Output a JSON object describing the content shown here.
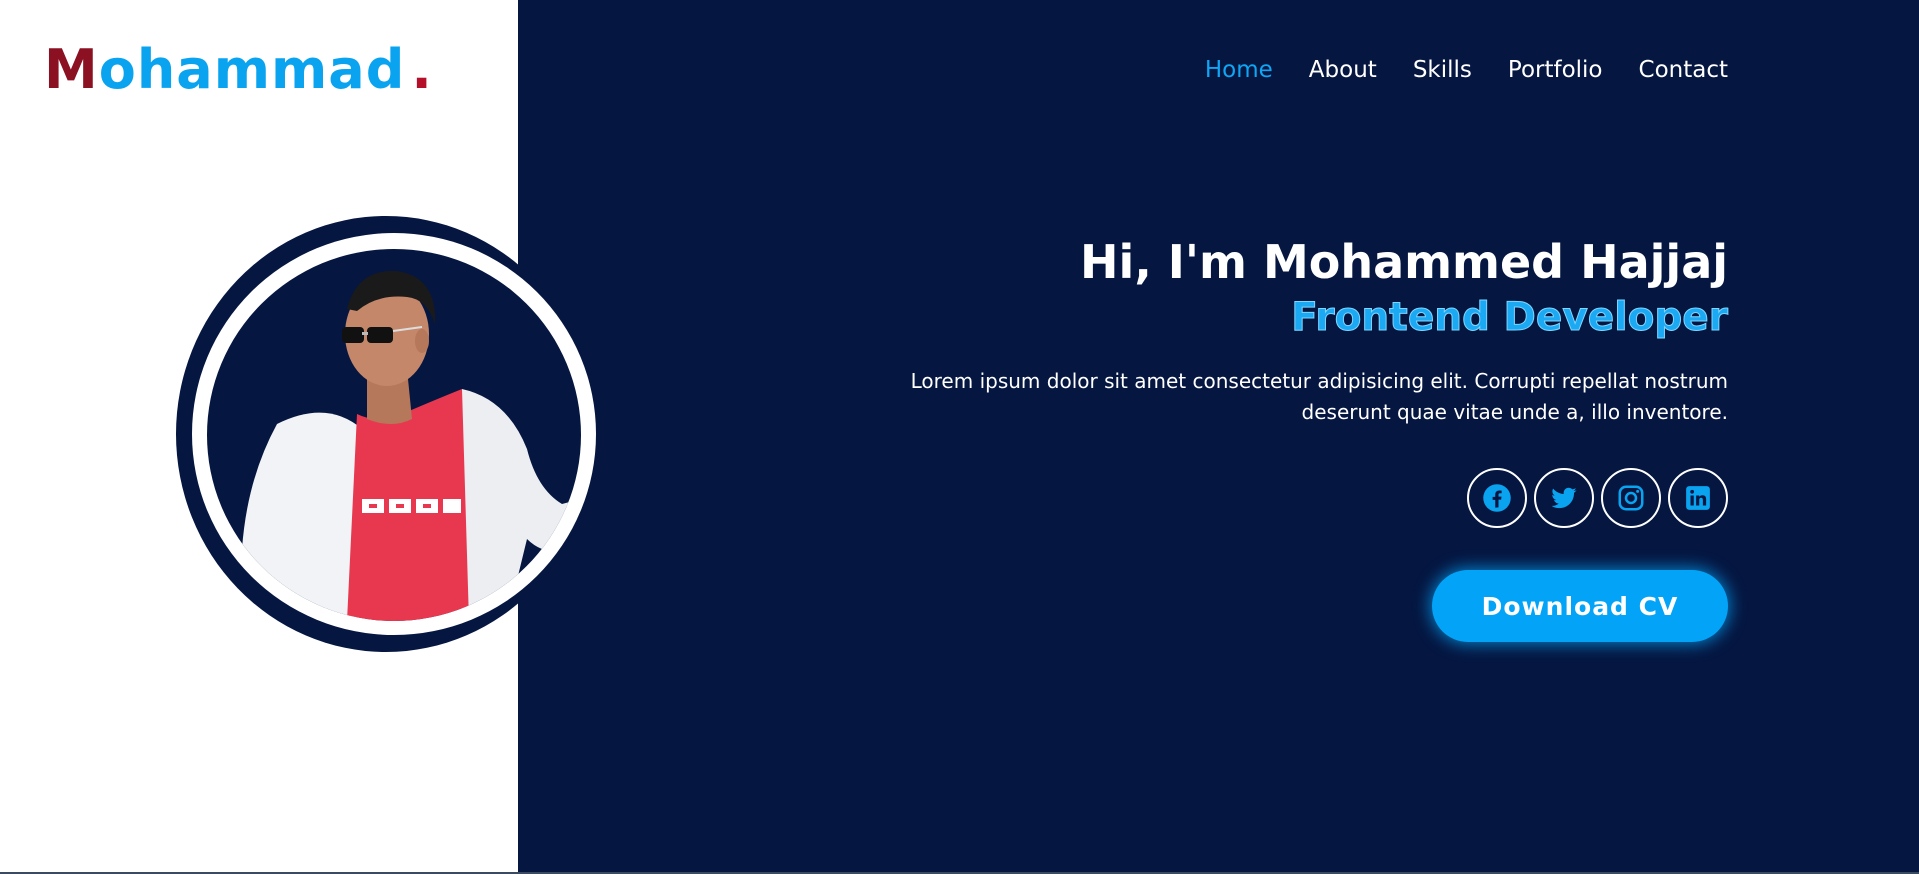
{
  "logo": {
    "first_letter": "M",
    "rest": "ohammad",
    "dot": "."
  },
  "nav": {
    "items": [
      {
        "label": "Home",
        "active": true
      },
      {
        "label": "About",
        "active": false
      },
      {
        "label": "Skills",
        "active": false
      },
      {
        "label": "Portfolio",
        "active": false
      },
      {
        "label": "Contact",
        "active": false
      }
    ]
  },
  "hero": {
    "title": "Hi, I'm Mohammed Hajjaj",
    "subtitle": "Frontend Developer",
    "description": "Lorem ipsum dolor sit amet consectetur adipisicing elit. Corrupti repellat nostrum deserunt quae vitae unde a, illo inventore.",
    "cv_button": "Download CV"
  },
  "socials": [
    {
      "name": "facebook-icon"
    },
    {
      "name": "twitter-icon"
    },
    {
      "name": "instagram-icon"
    },
    {
      "name": "linkedin-icon"
    }
  ],
  "colors": {
    "navy": "#051641",
    "accent": "#0aa3f0",
    "logo_dark_red": "#8a1022",
    "shirt_red": "#e8384f"
  }
}
